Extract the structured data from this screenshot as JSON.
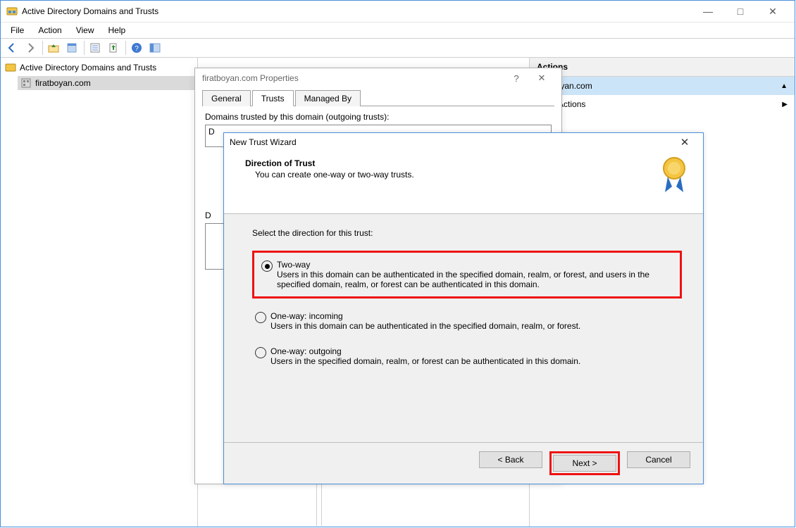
{
  "app": {
    "title": "Active Directory Domains and Trusts",
    "menus": [
      "File",
      "Action",
      "View",
      "Help"
    ]
  },
  "tree": {
    "root": "Active Directory Domains and Trusts",
    "child": "firatboyan.com"
  },
  "actions": {
    "header": "Actions",
    "highlight": "firatboyan.com",
    "more": "More Actions"
  },
  "props": {
    "title": "firatboyan.com Properties",
    "tabs": [
      "General",
      "Trusts",
      "Managed By"
    ],
    "active_tab": 1,
    "section1_label": "Domains trusted by this domain (outgoing trusts):",
    "section1_col": "D",
    "section2_label": "D",
    "listbox_placeholder": ""
  },
  "wizard": {
    "title": "New Trust Wizard",
    "heading": "Direction of Trust",
    "subheading": "You can create one-way or two-way trusts.",
    "prompt": "Select the direction for this trust:",
    "options": [
      {
        "label": "Two-way",
        "desc": "Users in this domain can be authenticated in the specified domain, realm, or forest, and users in the specified domain, realm, or forest can be authenticated in this domain.",
        "selected": true,
        "highlight": true
      },
      {
        "label": "One-way: incoming",
        "desc": "Users in this domain can be authenticated in the specified domain, realm, or forest.",
        "selected": false,
        "highlight": false
      },
      {
        "label": "One-way: outgoing",
        "desc": "Users in the specified domain, realm, or forest can be authenticated in this domain.",
        "selected": false,
        "highlight": false
      }
    ],
    "buttons": {
      "back": "< Back",
      "next": "Next >",
      "cancel": "Cancel"
    }
  }
}
